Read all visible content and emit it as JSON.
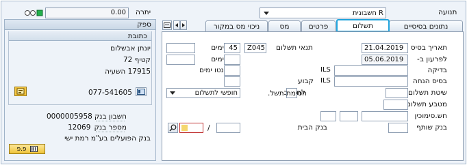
{
  "top": {
    "transaction_label": "תנועה",
    "doc_type_value": "R חשבונית",
    "balance_label": "יתרה",
    "balance_value": "0.00"
  },
  "vendor": {
    "header": "ספק",
    "address_header": "כתובת",
    "name": "יונתן אבשלום",
    "street": "קטיף 72",
    "city": "17915 השעיה",
    "phone": "077-541605",
    "bank_account_label": "חשבון בנק",
    "bank_account_value": "0000005958",
    "bank_number_label": "מספר בנק",
    "bank_number_value": "12069",
    "bank_name": "בנק הפועלים בע\"מ רמת ישי",
    "details_button": "פ.פ"
  },
  "tabs": [
    {
      "label": "נתונים בסיסיים"
    },
    {
      "label": "תשלום"
    },
    {
      "label": "פרטים"
    },
    {
      "label": "מס"
    },
    {
      "label": "ניכוי מס במקור"
    }
  ],
  "form": {
    "baseline_date_label": "תאריך בסיס",
    "baseline_date_value": "21.04.2019",
    "due_on_label": "לפרעון ב-",
    "due_on_value": "05.06.2019",
    "pay_terms_label": "תנאי תשלום",
    "pay_terms_value": "Z045",
    "days_label_1": "ימים",
    "days_value_1": "45",
    "days_label_2": "ימים",
    "net_days_label": "נטו ימים",
    "check_label": "בדיקה",
    "check_currency": "ILS",
    "discount_base_label": "בסיס הנחה",
    "discount_currency": "ILS",
    "calculate_label": "לחישוב",
    "fixed_label": "קבוע",
    "pay_method_label": "שיטת תשלום",
    "pay_block_label": "חסימת תשל.",
    "pay_block_value": "חופשי לתשלום",
    "pay_currency_label": "מטבע תשלום",
    "invoice_ref_label": "חש.סימוכין",
    "partner_bank_label": "בנק שותף",
    "house_bank_label": "בנק הבית",
    "slash": "/"
  }
}
